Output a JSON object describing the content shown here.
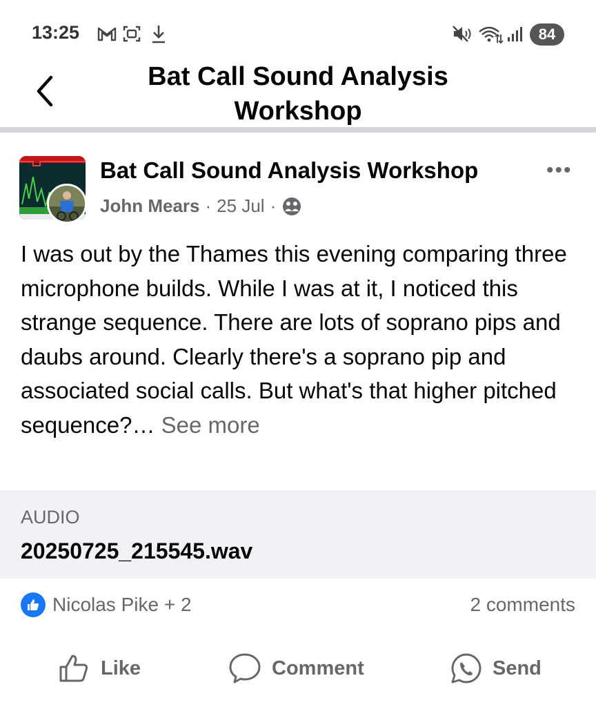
{
  "status_bar": {
    "time": "13:25",
    "battery": "84",
    "icons": [
      "gmail-icon",
      "screenshot-icon",
      "download-icon",
      "mute-icon",
      "wifi-icon",
      "signal-icon"
    ]
  },
  "header": {
    "back_icon": "chevron-left-icon",
    "title": "Bat Call Sound Analysis Workshop"
  },
  "post": {
    "group_name": "Bat Call Sound Analysis Workshop",
    "author": "John Mears",
    "date": "25 Jul",
    "separator": "·",
    "privacy_icon": "members-icon",
    "more_icon": "more-dots-icon",
    "more_label": "•••",
    "text": "I was out by the Thames this evening comparing three microphone builds. While I was at it, I noticed this strange sequence. There are lots of soprano pips and daubs around. Clearly there's a soprano pip and associated social calls. But what's that higher pitched sequence?…",
    "see_more": "See more"
  },
  "attachment": {
    "label": "AUDIO",
    "filename": "20250725_215545.wav"
  },
  "reactions": {
    "icon": "like-reaction-icon",
    "summary": "Nicolas Pike + 2",
    "comments": "2 comments"
  },
  "actions": {
    "like": "Like",
    "comment": "Comment",
    "send": "Send"
  },
  "colors": {
    "accent": "#1877f2",
    "secondary_text": "#65676b",
    "attachment_bg": "#f0f2f5",
    "divider": "#d4d6db"
  }
}
